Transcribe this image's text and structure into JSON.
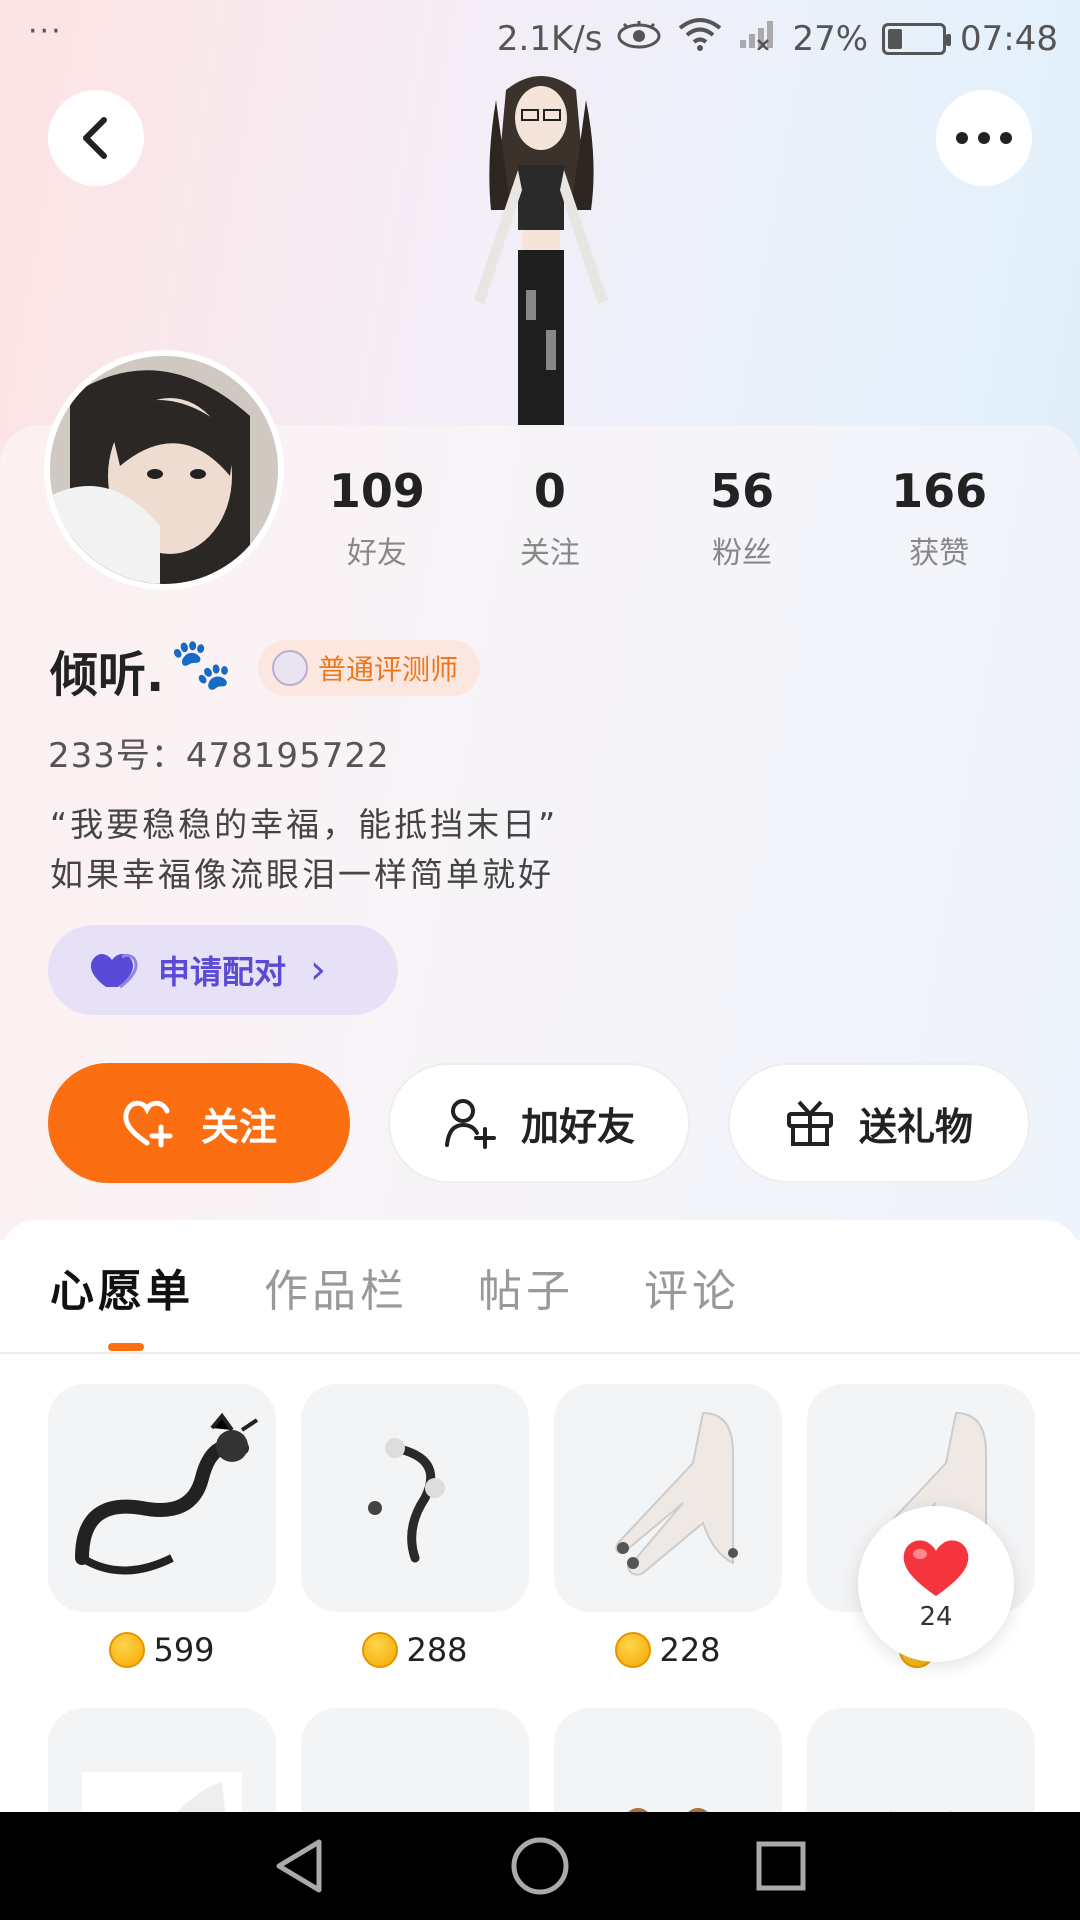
{
  "status_bar": {
    "overflow": "···",
    "net_speed": "2.1K/s",
    "battery_percent": "27%",
    "battery_level": 0.27,
    "time": "07:48"
  },
  "profile": {
    "stats": [
      {
        "num": "109",
        "label": "好友"
      },
      {
        "num": "0",
        "label": "关注"
      },
      {
        "num": "56",
        "label": "粉丝"
      },
      {
        "num": "166",
        "label": "获赞"
      }
    ],
    "username": "倾听.",
    "paws": "🐾",
    "badge": "普通评测师",
    "id_label": "233号：",
    "id_value": "478195722",
    "bio_line1": "“我要稳稳的幸福，能抵挡末日”",
    "bio_line2": "如果幸福像流眼泪一样简单就好",
    "pair_label": "申请配对",
    "pair_chevron": "›"
  },
  "actions": {
    "follow": "关注",
    "add_friend": "加好友",
    "send_gift": "送礼物"
  },
  "tabs": [
    "心愿单",
    "作品栏",
    "帖子",
    "评论"
  ],
  "wishlist": [
    {
      "price": "599",
      "icon": "dragon"
    },
    {
      "price": "288",
      "icon": "hair-accessory"
    },
    {
      "price": "228",
      "icon": "glove-nails"
    },
    {
      "price": "",
      "icon": "glove-nails"
    }
  ],
  "like_float": {
    "count": "24"
  },
  "colors": {
    "accent": "#fb6f12",
    "pair": "#5a4bd6"
  }
}
